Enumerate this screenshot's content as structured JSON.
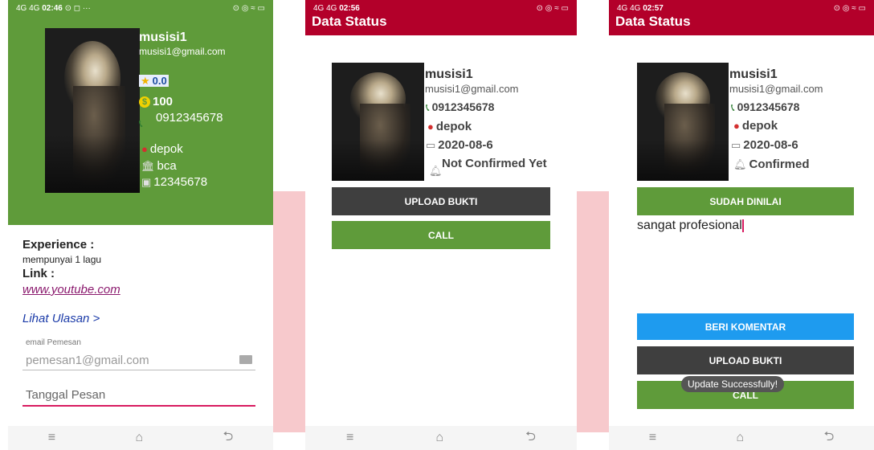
{
  "screen1": {
    "status": {
      "network": "4G 4G",
      "time": "02:46",
      "extras": "⊙ ◻ ···",
      "right": "⊙ ◎ ≈ ▭"
    },
    "profile": {
      "name": "musisi1",
      "email": "musisi1@gmail.com",
      "rating": "0.0",
      "price": "100",
      "phone": "0912345678",
      "city": "depok",
      "bank": "bca",
      "account": "12345678"
    },
    "experience_label": "Experience :",
    "experience_value": "mempunyai 1 lagu",
    "link_label": "Link :",
    "link_value": "www.youtube.com",
    "reviews_link": "Lihat Ulasan >",
    "email_label": "email Pemesan",
    "email_value": "pemesan1@gmail.com",
    "date_placeholder": "Tanggal Pesan"
  },
  "screen2": {
    "status": {
      "network": "4G 4G",
      "time": "02:56",
      "right": "⊙ ◎ ≈ ▭"
    },
    "title": "Data Status",
    "name": "musisi1",
    "email": "musisi1@gmail.com",
    "phone": "0912345678",
    "city": "depok",
    "date": "2020-08-6",
    "status_text": "Not Confirmed Yet",
    "upload_button": "UPLOAD BUKTI",
    "call_button": "CALL"
  },
  "screen3": {
    "status": {
      "network": "4G 4G",
      "time": "02:57",
      "right": "⊙ ◎ ≈ ▭"
    },
    "title": "Data Status",
    "name": "musisi1",
    "email": "musisi1@gmail.com",
    "phone": "0912345678",
    "city": "depok",
    "date": "2020-08-6",
    "status_text": "Confirmed",
    "rated_button": "SUDAH DINILAI",
    "comment": "sangat profesional",
    "comment_button": "BERI KOMENTAR",
    "upload_button": "UPLOAD BUKTI",
    "call_button": "CALL",
    "toast": "Update Successfully!"
  },
  "nav": {
    "menu": "≡",
    "home": "⌂",
    "back": "⮌"
  },
  "colors": {
    "green": "#5f9b3a",
    "appbar": "#b3002a",
    "blue": "#1e9bef",
    "dark": "#3f3f3f"
  }
}
